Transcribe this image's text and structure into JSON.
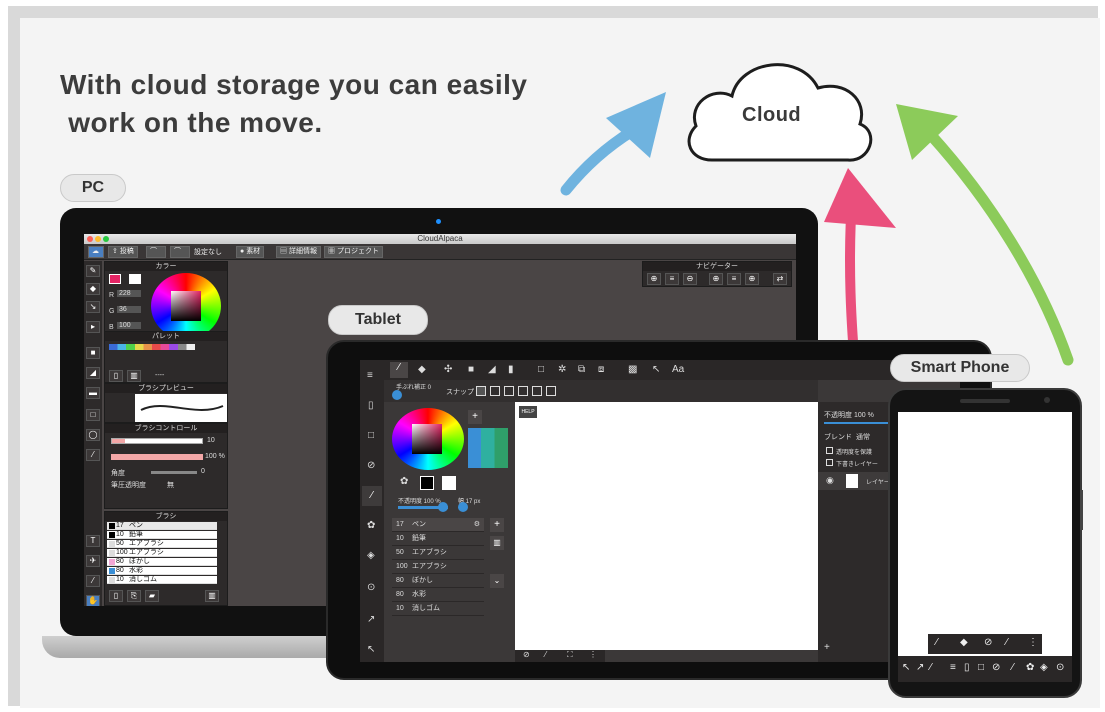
{
  "headline": {
    "line1": "With cloud storage you can easily",
    "line2": " work on the move."
  },
  "cloud": {
    "label": "Cloud"
  },
  "labels": {
    "pc": "PC",
    "tablet": "Tablet",
    "smartphone": "Smart Phone"
  },
  "colors": {
    "arrow_pc": "#6fb3df",
    "arrow_tablet": "#ea4f7c",
    "arrow_phone": "#8ccb5a"
  },
  "laptop": {
    "window_title": "CloudAlpaca",
    "toolbar": {
      "post": "投稿",
      "setting": "設定なし",
      "material": "素材",
      "detail": "詳細情報",
      "project": "プロジェクト"
    },
    "color_panel": {
      "title": "カラー",
      "r_label": "R",
      "r_value": "228",
      "g_label": "G",
      "g_value": "36",
      "b_label": "B",
      "b_value": "100"
    },
    "palette": {
      "title": "パレット",
      "page": "----"
    },
    "brush_preview": {
      "title": "ブラシプレビュー"
    },
    "brush_control": {
      "title": "ブラシコントロール",
      "size": "10",
      "opacity": "100 %",
      "angle_label": "角度",
      "angle_value": "0",
      "pressure_label": "筆圧透明度",
      "pressure_value": "無"
    },
    "brush_list": {
      "title": "ブラシ",
      "items": [
        {
          "size": "17",
          "name": "ペン"
        },
        {
          "size": "10",
          "name": "鉛筆"
        },
        {
          "size": "50",
          "name": "エアブラシ"
        },
        {
          "size": "100",
          "name": "エアブラシ"
        },
        {
          "size": "80",
          "name": "ぼかし"
        },
        {
          "size": "80",
          "name": "水彩"
        },
        {
          "size": "10",
          "name": "消しゴム"
        }
      ]
    },
    "navigator": {
      "title": "ナビゲーター"
    }
  },
  "tablet": {
    "hand_correction": "手ぶれ補正 0",
    "snap": "スナップ",
    "font_btn": "Aa",
    "help": "HELP",
    "opacity": "不透明度 100 %",
    "width": "幅 17 px",
    "brushes": [
      {
        "size": "17",
        "name": "ペン"
      },
      {
        "size": "10",
        "name": "鉛筆"
      },
      {
        "size": "50",
        "name": "エアブラシ"
      },
      {
        "size": "100",
        "name": "エアブラシ"
      },
      {
        "size": "80",
        "name": "ぼかし"
      },
      {
        "size": "80",
        "name": "水彩"
      },
      {
        "size": "10",
        "name": "消しゴム"
      }
    ],
    "layer_panel": {
      "opacity": "不透明度 100 %",
      "blend_label": "ブレンド",
      "blend_value": "通常",
      "protect_alpha": "透明度を保護",
      "draft_layer": "下書きレイヤー",
      "layer_name": "レイヤー"
    }
  }
}
